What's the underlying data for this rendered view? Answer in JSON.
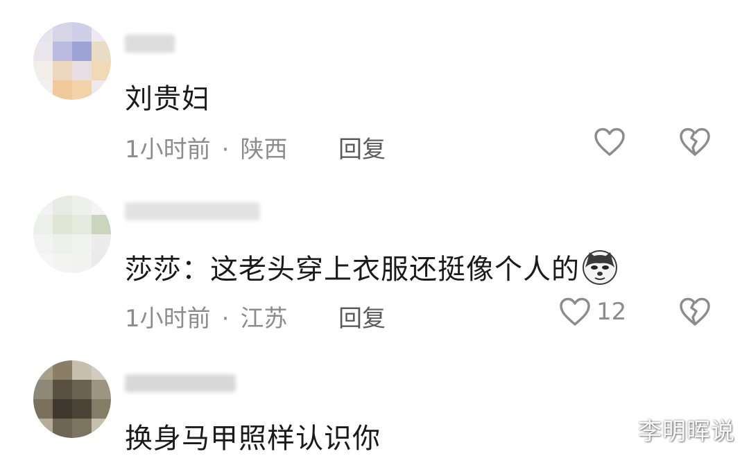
{
  "comments": [
    {
      "text": "刘贵妇",
      "time": "1小时前",
      "separator": "·",
      "location": "陕西",
      "reply_label": "回复",
      "like_count": ""
    },
    {
      "text": "莎莎：这老头穿上衣服还挺像个人的",
      "time": "1小时前",
      "separator": "·",
      "location": "江苏",
      "reply_label": "回复",
      "like_count": "12",
      "emoji": "doge-emoji"
    },
    {
      "text": "换身马甲照样认识你"
    }
  ],
  "watermark": "李明晖说",
  "icons": {
    "like": "heart-outline-icon",
    "dislike": "broken-heart-icon"
  },
  "colors": {
    "text": "#1a1a1a",
    "meta": "#8c8c8c",
    "reply": "#5a5a5a"
  }
}
